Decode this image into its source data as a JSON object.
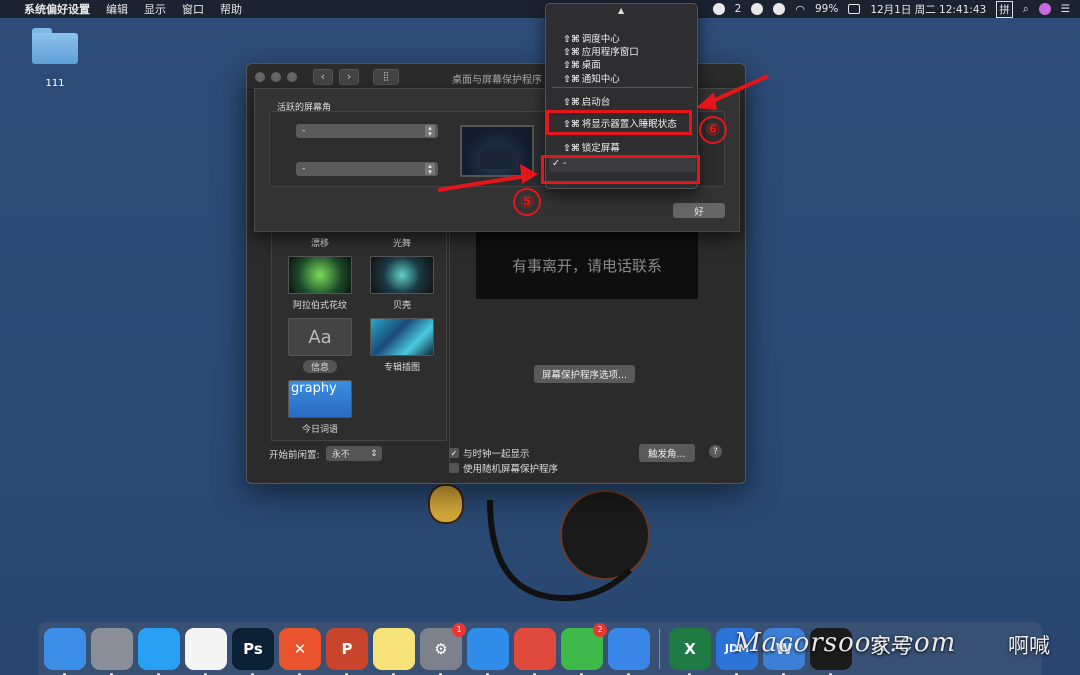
{
  "menubar": {
    "app_name": "系统偏好设置",
    "items": [
      "编辑",
      "显示",
      "窗口",
      "帮助"
    ],
    "badge_count": "2",
    "battery": "99%",
    "datetime": "12月1日 周二  12:41:43",
    "input_method": "拼"
  },
  "desktop": {
    "folder_label": "111"
  },
  "window": {
    "title": "桌面与屏幕保护程序",
    "savers": [
      {
        "label": "漂移"
      },
      {
        "label": "光舞"
      },
      {
        "label": "阿拉伯式花纹"
      },
      {
        "label": "贝壳"
      },
      {
        "label": "信息"
      },
      {
        "label": "专辑插图"
      },
      {
        "label": "今日词语"
      }
    ],
    "info_thumb_text": "Aa",
    "word_thumb_text": "graphy",
    "preview_text": "有事离开，请电话联系",
    "options_button": "屏幕保护程序选项...",
    "start_after_label": "开始前闲置:",
    "start_after_value": "永不",
    "show_clock_label": "与时钟一起显示",
    "random_label": "使用随机屏幕保护程序",
    "hot_corners_button": "触发角...",
    "help": "?"
  },
  "sheet": {
    "title": "活跃的屏幕角",
    "corner_tl": "-",
    "corner_bl": "-",
    "ok_button": "好"
  },
  "popup": {
    "items": [
      {
        "shortcut": "⇧⌘",
        "label": "调度中心"
      },
      {
        "shortcut": "⇧⌘",
        "label": "应用程序窗口"
      },
      {
        "shortcut": "⇧⌘",
        "label": "桌面"
      },
      {
        "shortcut": "⇧⌘",
        "label": "通知中心"
      },
      {
        "shortcut": "⇧⌘",
        "label": "启动台"
      },
      {
        "shortcut": "⇧⌘",
        "label": "将显示器置入睡眠状态"
      },
      {
        "shortcut": "⇧⌘",
        "label": "锁定屏幕"
      }
    ],
    "selected_check": "✓",
    "selected_label": "-"
  },
  "annotations": {
    "step5": "⑤",
    "step6": "⑥",
    "color": "#e3161c"
  },
  "dock": {
    "apps": [
      {
        "name": "finder-icon",
        "text": "",
        "color": "#3d8ee8"
      },
      {
        "name": "launchpad-icon",
        "text": "",
        "color": "#8a8f99"
      },
      {
        "name": "messages-icon",
        "text": "",
        "color": "#2aa0f5"
      },
      {
        "name": "reminders-icon",
        "text": "",
        "color": "#f4f4f4"
      },
      {
        "name": "photoshop-icon",
        "text": "Ps",
        "color": "#0b1f35"
      },
      {
        "name": "xmind-icon",
        "text": "✕",
        "color": "#e9532e"
      },
      {
        "name": "powerpoint-icon",
        "text": "P",
        "color": "#c8452b"
      },
      {
        "name": "notes-icon",
        "text": "",
        "color": "#f7e27a"
      },
      {
        "name": "system-preferences-icon",
        "text": "⚙",
        "color": "#7d818a",
        "badge": "1"
      },
      {
        "name": "safari-icon",
        "text": "",
        "color": "#2f8ce8"
      },
      {
        "name": "chrome-icon",
        "text": "",
        "color": "#e04a3c"
      },
      {
        "name": "wechat-icon",
        "text": "",
        "color": "#3fb94a",
        "badge": "2"
      },
      {
        "name": "feishu-icon",
        "text": "",
        "color": "#3a86e8"
      },
      {
        "name": "excel-icon",
        "text": "X",
        "color": "#1f7a44"
      },
      {
        "name": "jdm-icon",
        "text": "JDM",
        "color": "#2d74d8"
      },
      {
        "name": "app-icon",
        "text": "W",
        "color": "#3d7fd6"
      },
      {
        "name": "qq-icon",
        "text": "",
        "color": "#1b1b1b"
      }
    ],
    "watermark_latin": "Macorsoon.com",
    "watermark_cn": "家号",
    "watermark_cn2": "啊喊"
  }
}
